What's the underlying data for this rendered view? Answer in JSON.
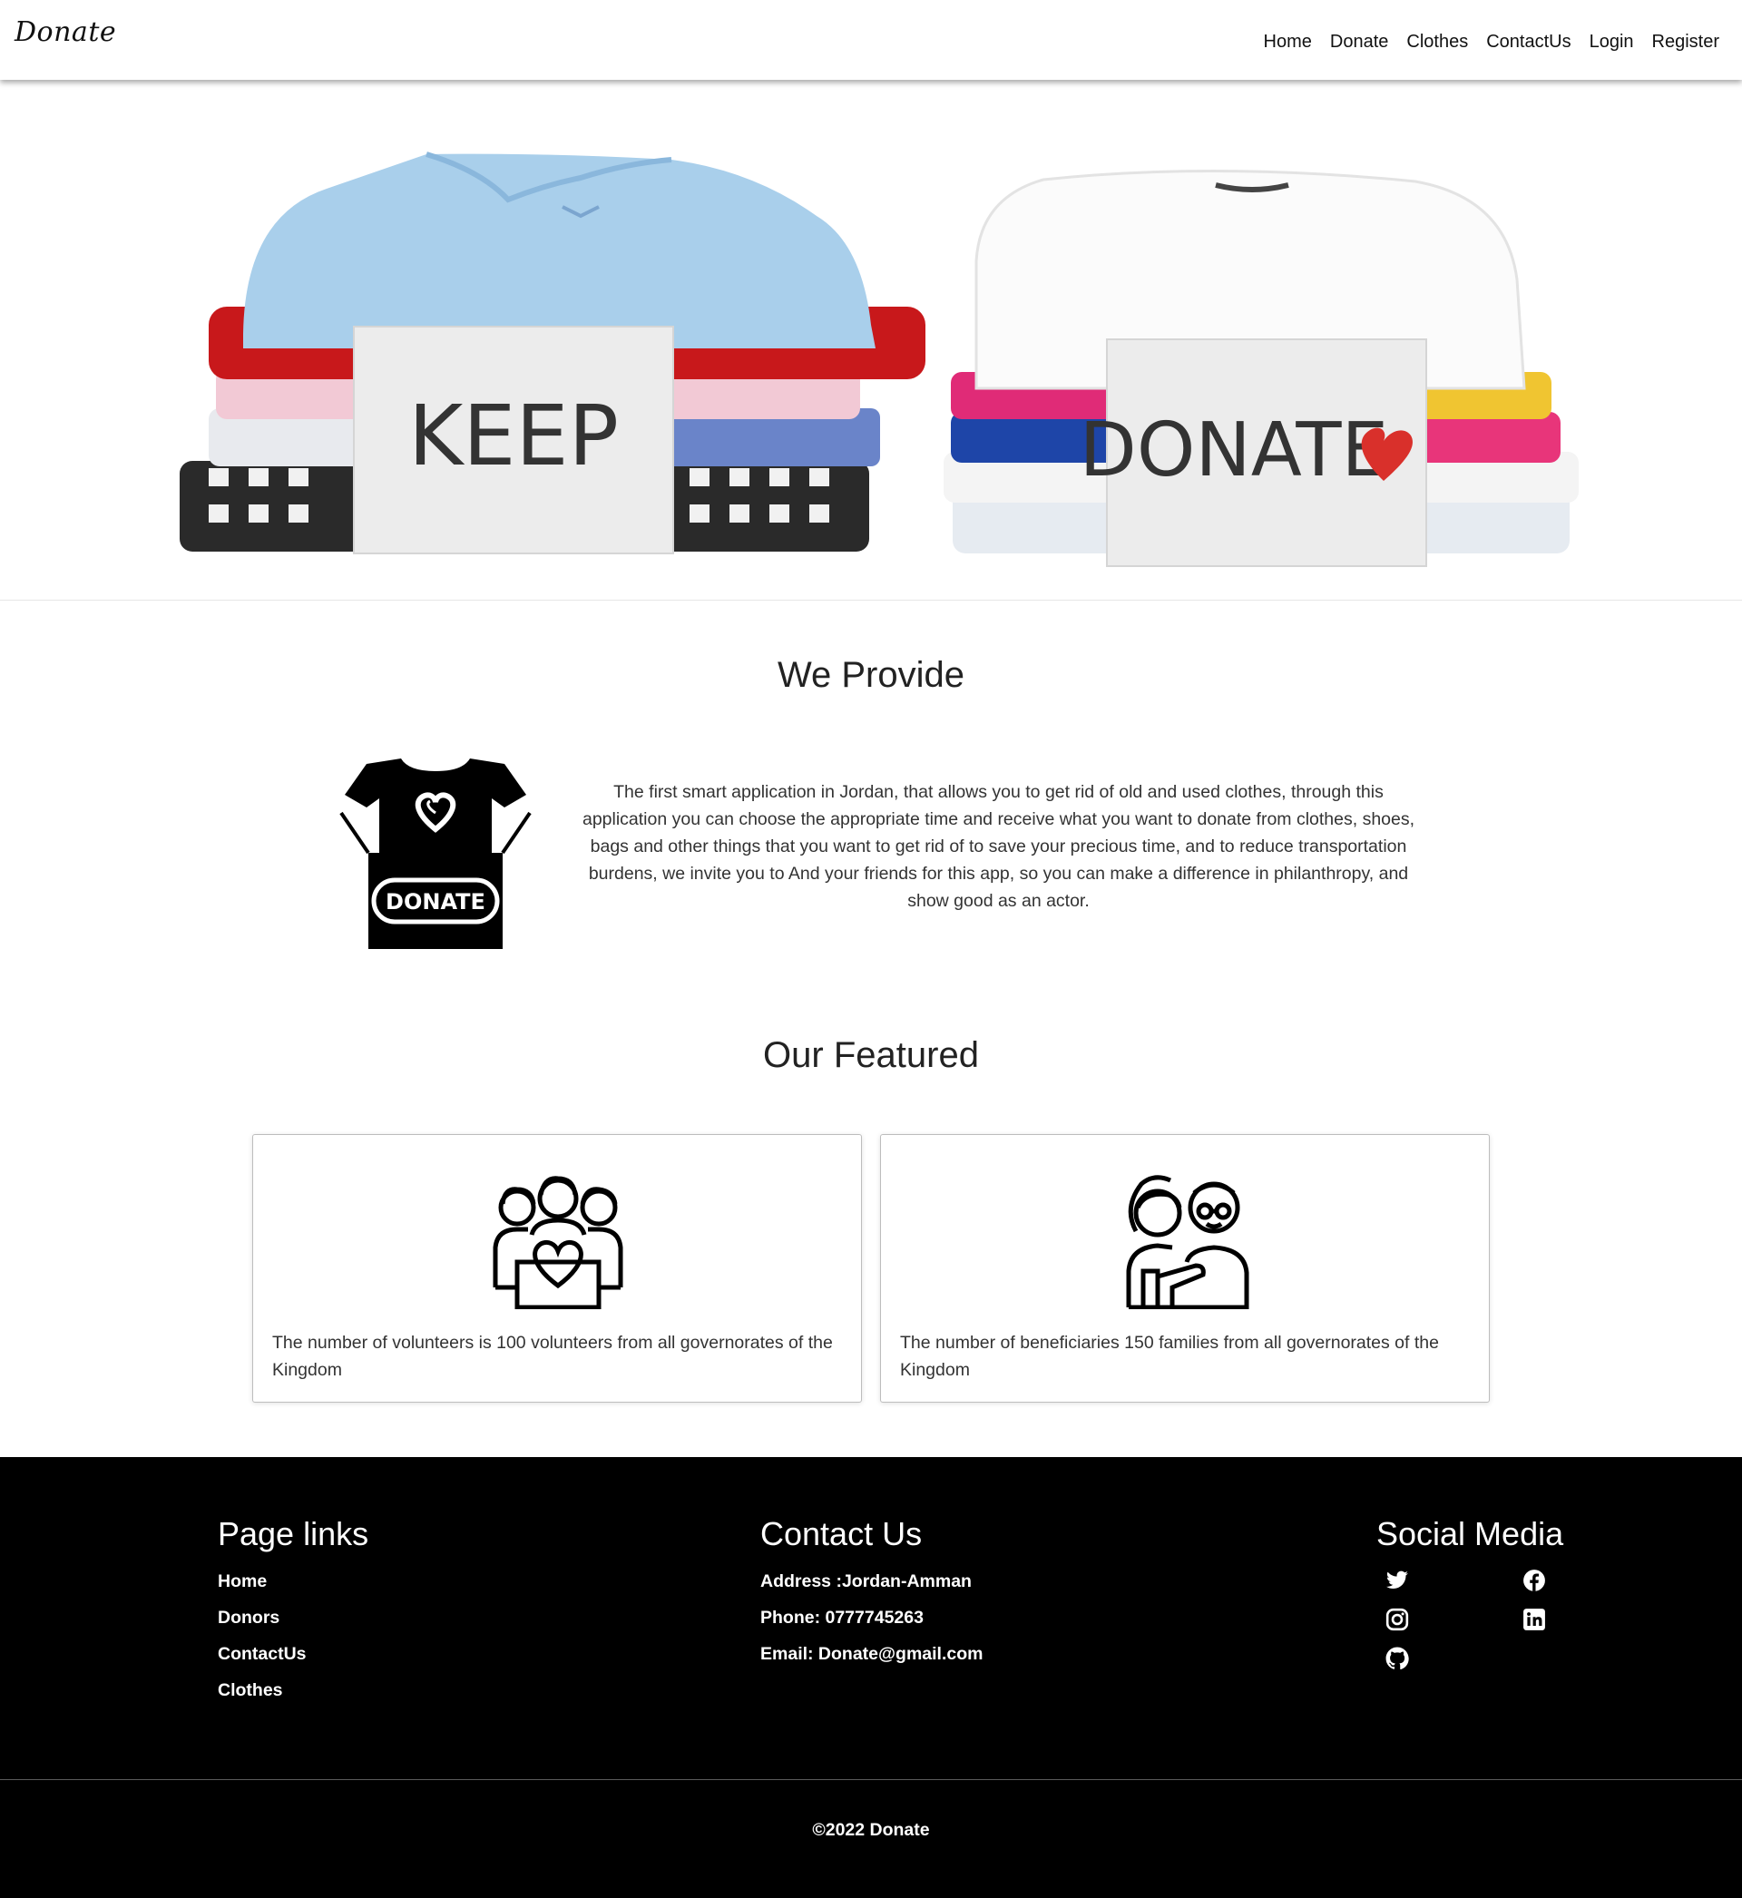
{
  "navbar": {
    "brand": "Donate",
    "links": [
      "Home",
      "Donate",
      "Clothes",
      "ContactUs",
      "Login",
      "Register"
    ]
  },
  "hero": {
    "left_sign": "KEEP",
    "right_sign": "DONATE"
  },
  "provide": {
    "title": "We Provide",
    "icon_label": "DONATE",
    "text": "The first smart application in Jordan, that allows you to get rid of old and used clothes, through this application you can choose the appropriate time and receive what you want to donate from clothes, shoes, bags and other things that you want to get rid of to save your precious time, and to reduce transportation burdens, we invite you to And your friends for this app, so you can make a difference in philanthropy, and show good as an actor."
  },
  "featured": {
    "title": "Our Featured",
    "cards": [
      {
        "icon": "volunteers-icon",
        "text": "The number of volunteers is 100 volunteers from all governorates of the Kingdom"
      },
      {
        "icon": "beneficiaries-icon",
        "text": "The number of beneficiaries 150 families from all governorates of the Kingdom"
      }
    ]
  },
  "footer": {
    "page_links": {
      "heading": "Page links",
      "items": [
        "Home",
        "Donors",
        "ContactUs",
        "Clothes"
      ]
    },
    "contact": {
      "heading": "Contact Us",
      "address": "Address :Jordan-Amman",
      "phone": "Phone: 0777745263",
      "email": "Email: Donate@gmail.com"
    },
    "social": {
      "heading": "Social Media",
      "icons": [
        "twitter-icon",
        "facebook-icon",
        "instagram-icon",
        "linkedin-icon",
        "github-icon"
      ]
    },
    "copyright": "©2022 Donate"
  },
  "colors": {
    "footer_bg": "#000000",
    "heart": "#d9302b",
    "shirt_blue": "#a9cfeb",
    "shirt_red": "#c8181b"
  }
}
